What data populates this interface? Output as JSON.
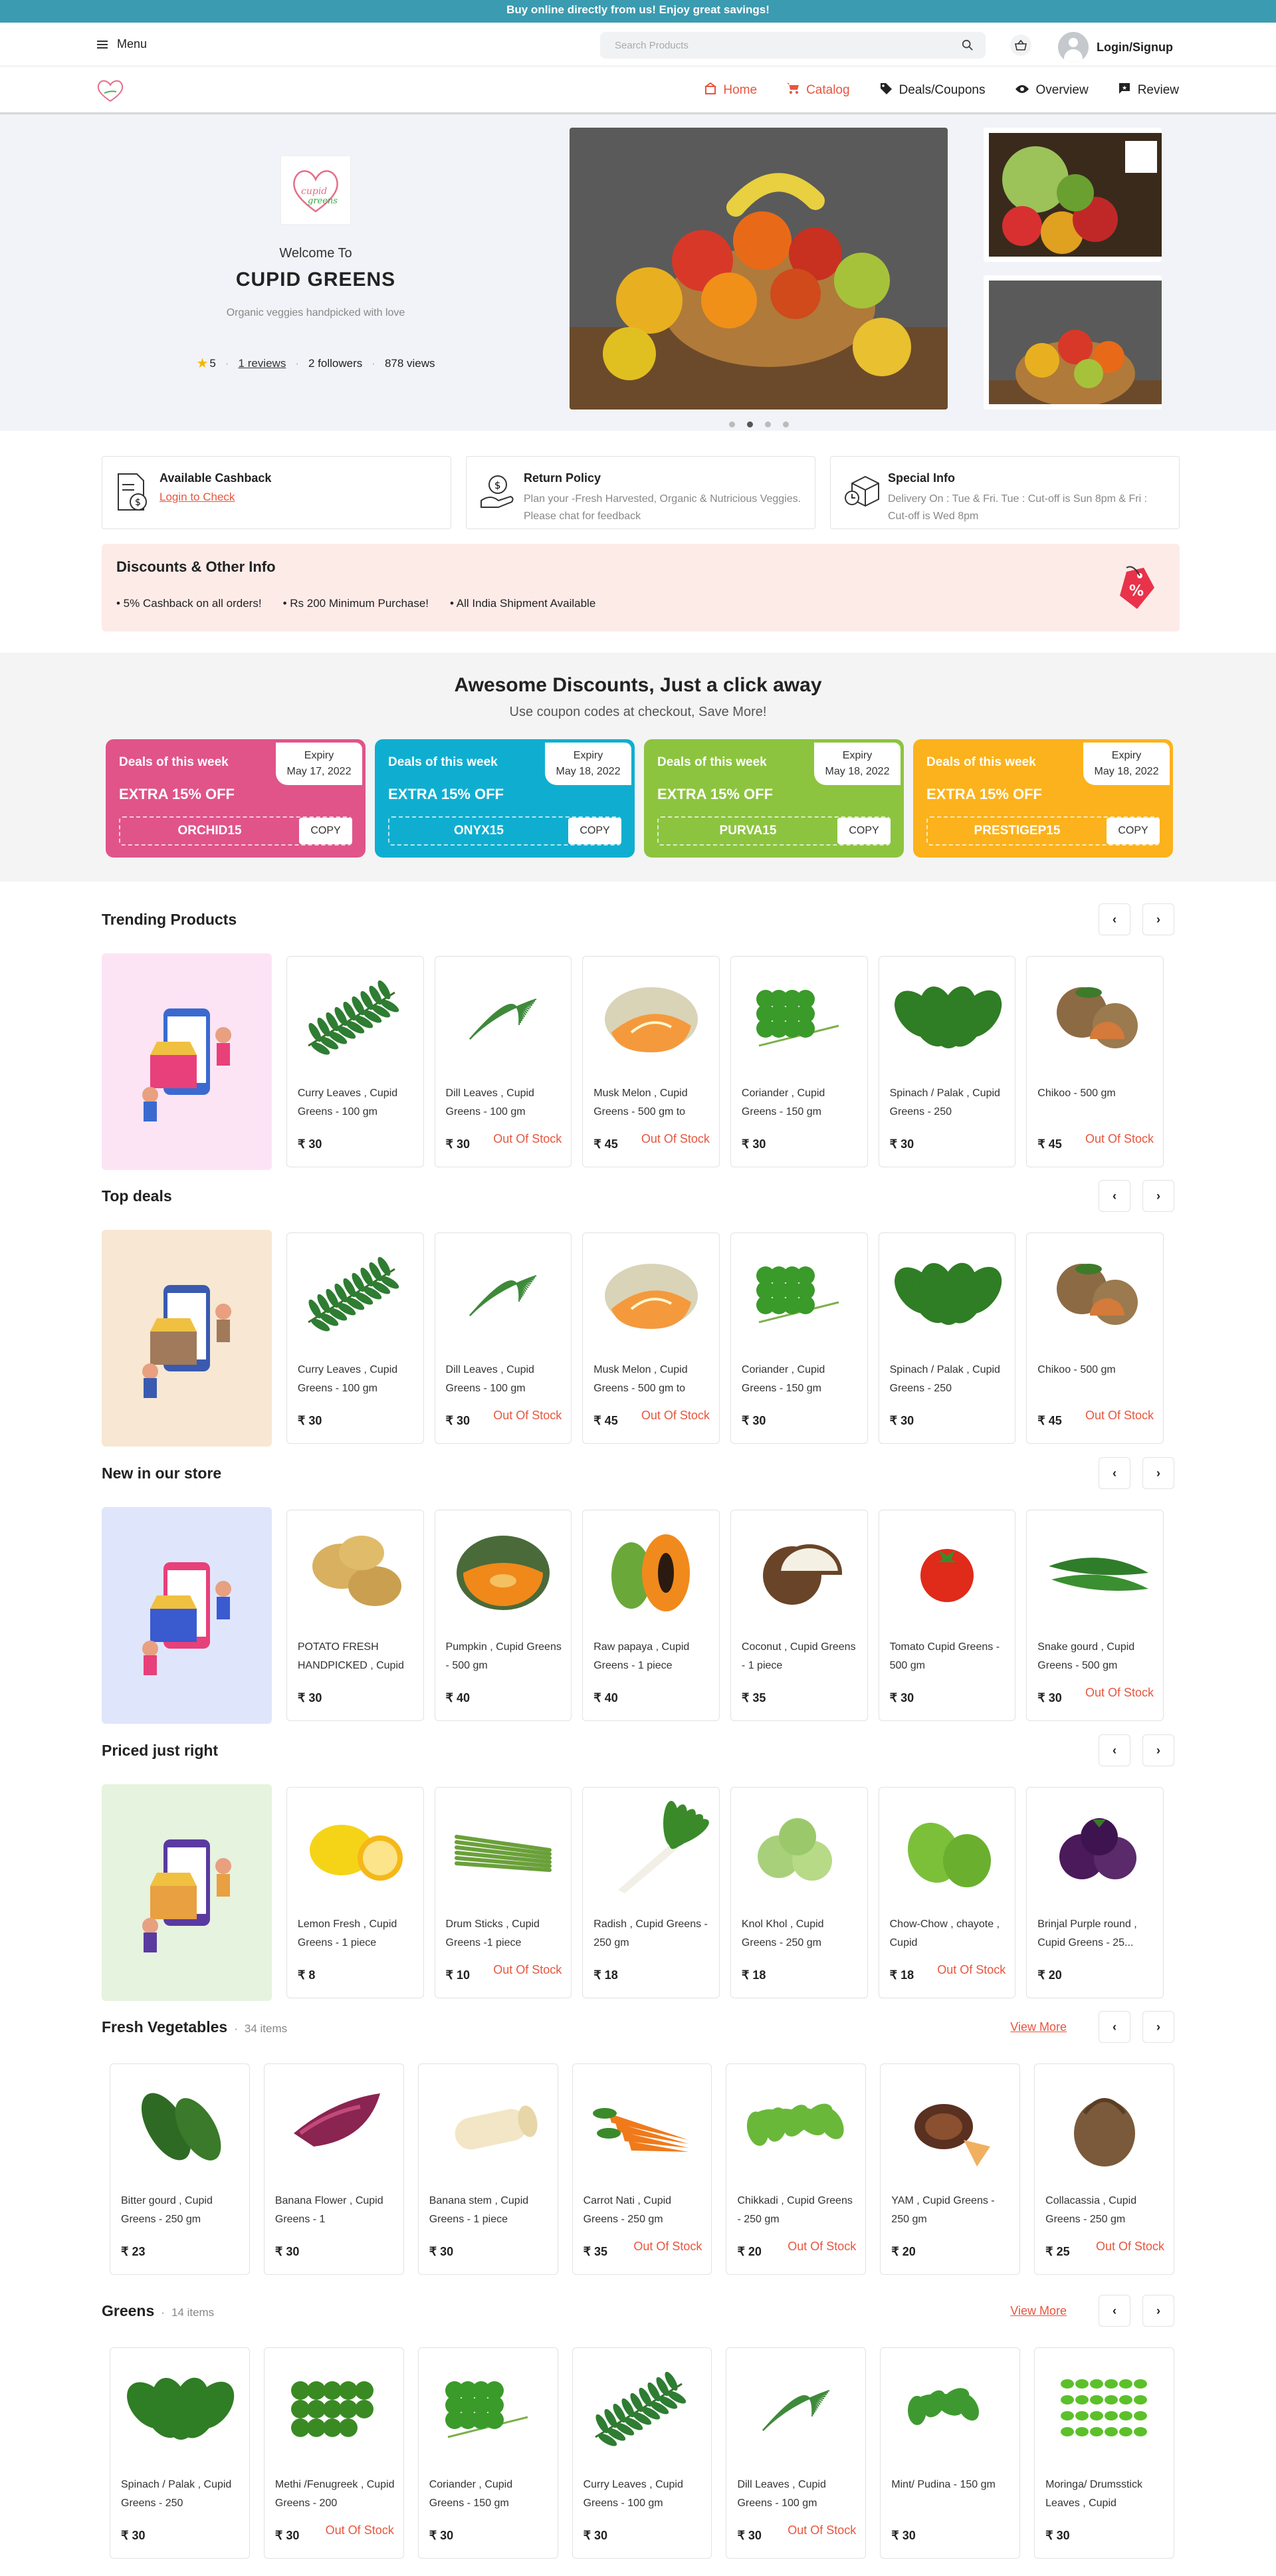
{
  "topbar": {
    "text": "Buy online directly from us! Enjoy great savings!"
  },
  "header": {
    "menu_label": "Menu",
    "search_placeholder": "Search Products",
    "login_label": "Login/Signup"
  },
  "nav": {
    "items": [
      {
        "label": "Home",
        "icon": "home-icon",
        "active": true
      },
      {
        "label": "Catalog",
        "icon": "cart-icon",
        "active": true
      },
      {
        "label": "Deals/Coupons",
        "icon": "tag-icon",
        "active": false
      },
      {
        "label": "Overview",
        "icon": "eye-icon",
        "active": false
      },
      {
        "label": "Review",
        "icon": "review-icon",
        "active": false
      }
    ]
  },
  "hero": {
    "welcome": "Welcome To",
    "store_name": "CUPID GREENS",
    "tagline": "Organic veggies handpicked with love",
    "rating": "5",
    "reviews": "1 reviews",
    "followers": "2 followers",
    "views": "878 views",
    "logo_text": "cupid greens",
    "slide_count": 4,
    "active_slide": 2
  },
  "info": {
    "cashback": {
      "title": "Available Cashback",
      "link": "Login to Check"
    },
    "returns": {
      "title": "Return Policy",
      "text": "Plan your -Fresh Harvested, Organic & Nutricious Veggies. Please chat for feedback"
    },
    "special": {
      "title": "Special Info",
      "text": "Delivery On : Tue & Fri. Tue : Cut-off is Sun 8pm & Fri : Cut-off is Wed 8pm"
    }
  },
  "discounts": {
    "title": "Discounts & Other Info",
    "items": [
      "• 5% Cashback on all orders!",
      "• Rs 200 Minimum Purchase!",
      "• All India Shipment Available"
    ]
  },
  "coupons": {
    "title": "Awesome Discounts, Just a click away",
    "subtitle": "Use coupon codes at checkout, Save More!",
    "copy_label": "COPY",
    "list": [
      {
        "deal": "Deals of this week",
        "offer": "EXTRA 15% OFF",
        "expiry_label": "Expiry",
        "expiry": "May 17, 2022",
        "code": "ORCHID15",
        "color": "#e0548a"
      },
      {
        "deal": "Deals of this week",
        "offer": "EXTRA 15% OFF",
        "expiry_label": "Expiry",
        "expiry": "May 18, 2022",
        "code": "ONYX15",
        "color": "#0faed0"
      },
      {
        "deal": "Deals of this week",
        "offer": "EXTRA 15% OFF",
        "expiry_label": "Expiry",
        "expiry": "May 18, 2022",
        "code": "PURVA15",
        "color": "#8cc43f"
      },
      {
        "deal": "Deals of this week",
        "offer": "EXTRA 15% OFF",
        "expiry_label": "Expiry",
        "expiry": "May 18, 2022",
        "code": "PRESTIGEP15",
        "color": "#fbb21c"
      }
    ]
  },
  "sections": [
    {
      "title": "Trending Products",
      "count": "",
      "view_more": "",
      "banner_color": "#fce4f5",
      "products": [
        {
          "name": "Curry Leaves , Cupid Greens - 100 gm",
          "price": "₹ 30",
          "stock": "",
          "img": "curry"
        },
        {
          "name": "Dill Leaves , Cupid Greens - 100 gm",
          "price": "₹ 30",
          "stock": "Out Of Stock",
          "img": "dill"
        },
        {
          "name": "Musk Melon , Cupid Greens - 500 gm to",
          "price": "₹ 45",
          "stock": "Out Of Stock",
          "img": "melon"
        },
        {
          "name": "Coriander , Cupid Greens - 150 gm",
          "price": "₹ 30",
          "stock": "",
          "img": "coriander"
        },
        {
          "name": "Spinach / Palak , Cupid Greens - 250",
          "price": "₹ 30",
          "stock": "",
          "img": "spinach"
        },
        {
          "name": "Chikoo - 500 gm",
          "price": "₹ 45",
          "stock": "Out Of Stock",
          "img": "chikoo"
        }
      ]
    },
    {
      "title": "Top deals",
      "count": "",
      "view_more": "",
      "banner_color": "#f7e7d3",
      "products": [
        {
          "name": "Curry Leaves , Cupid Greens - 100 gm",
          "price": "₹ 30",
          "stock": "",
          "img": "curry"
        },
        {
          "name": "Dill Leaves , Cupid Greens - 100 gm",
          "price": "₹ 30",
          "stock": "Out Of Stock",
          "img": "dill"
        },
        {
          "name": "Musk Melon , Cupid Greens - 500 gm to",
          "price": "₹ 45",
          "stock": "Out Of Stock",
          "img": "melon"
        },
        {
          "name": "Coriander , Cupid Greens - 150 gm",
          "price": "₹ 30",
          "stock": "",
          "img": "coriander"
        },
        {
          "name": "Spinach / Palak , Cupid Greens - 250",
          "price": "₹ 30",
          "stock": "",
          "img": "spinach"
        },
        {
          "name": "Chikoo - 500 gm",
          "price": "₹ 45",
          "stock": "Out Of Stock",
          "img": "chikoo"
        }
      ]
    },
    {
      "title": "New in our store",
      "count": "",
      "view_more": "",
      "banner_color": "#dfe6fb",
      "products": [
        {
          "name": "POTATO FRESH HANDPICKED , Cupid",
          "price": "₹ 30",
          "stock": "",
          "img": "potato"
        },
        {
          "name": "Pumpkin , Cupid Greens - 500 gm",
          "price": "₹ 40",
          "stock": "",
          "img": "pumpkin"
        },
        {
          "name": "Raw papaya , Cupid Greens - 1 piece",
          "price": "₹ 40",
          "stock": "",
          "img": "papaya"
        },
        {
          "name": "Coconut , Cupid Greens - 1 piece",
          "price": "₹ 35",
          "stock": "",
          "img": "coconut"
        },
        {
          "name": "Tomato Cupid Greens - 500 gm",
          "price": "₹ 30",
          "stock": "",
          "img": "tomato"
        },
        {
          "name": "Snake gourd , Cupid Greens - 500 gm",
          "price": "₹ 30",
          "stock": "Out Of Stock",
          "img": "gourd"
        }
      ]
    },
    {
      "title": "Priced just right",
      "count": "",
      "view_more": "",
      "banner_color": "#e6f3df",
      "products": [
        {
          "name": "Lemon Fresh , Cupid Greens - 1 piece",
          "price": "₹ 8",
          "stock": "",
          "img": "lemon"
        },
        {
          "name": "Drum Sticks , Cupid Greens -1 piece",
          "price": "₹ 10",
          "stock": "Out Of Stock",
          "img": "drumstick"
        },
        {
          "name": "Radish , Cupid Greens - 250 gm",
          "price": "₹ 18",
          "stock": "",
          "img": "radish"
        },
        {
          "name": "Knol Khol , Cupid Greens - 250 gm",
          "price": "₹ 18",
          "stock": "",
          "img": "knolkhol"
        },
        {
          "name": "Chow-Chow , chayote , Cupid",
          "price": "₹ 18",
          "stock": "Out Of Stock",
          "img": "chayote"
        },
        {
          "name": "Brinjal Purple round , Cupid Greens - 25...",
          "price": "₹ 20",
          "stock": "",
          "img": "brinjal"
        }
      ]
    },
    {
      "title": "Fresh Vegetables",
      "count": "34 items",
      "view_more": "View More",
      "banner_color": "",
      "products": [
        {
          "name": "Bitter gourd , Cupid Greens - 250 gm",
          "price": "₹ 23",
          "stock": "",
          "img": "bitter"
        },
        {
          "name": "Banana Flower , Cupid Greens - 1",
          "price": "₹ 30",
          "stock": "",
          "img": "bananaflower"
        },
        {
          "name": "Banana stem , Cupid Greens - 1 piece",
          "price": "₹ 30",
          "stock": "",
          "img": "bananastem"
        },
        {
          "name": "Carrot Nati , Cupid Greens - 250 gm",
          "price": "₹ 35",
          "stock": "Out Of Stock",
          "img": "carrot"
        },
        {
          "name": "Chikkadi , Cupid Greens - 250 gm",
          "price": "₹ 20",
          "stock": "Out Of Stock",
          "img": "chikkadi"
        },
        {
          "name": "YAM , Cupid Greens - 250 gm",
          "price": "₹ 20",
          "stock": "",
          "img": "yam"
        },
        {
          "name": "Collacassia , Cupid Greens - 250 gm",
          "price": "₹ 25",
          "stock": "Out Of Stock",
          "img": "colocasia"
        }
      ]
    },
    {
      "title": "Greens",
      "count": "14 items",
      "view_more": "View More",
      "banner_color": "",
      "products": [
        {
          "name": "Spinach / Palak , Cupid Greens - 250",
          "price": "₹ 30",
          "stock": "",
          "img": "spinach"
        },
        {
          "name": "Methi /Fenugreek , Cupid Greens - 200",
          "price": "₹ 30",
          "stock": "Out Of Stock",
          "img": "methi"
        },
        {
          "name": "Coriander , Cupid Greens - 150 gm",
          "price": "₹ 30",
          "stock": "",
          "img": "coriander"
        },
        {
          "name": "Curry Leaves , Cupid Greens - 100 gm",
          "price": "₹ 30",
          "stock": "",
          "img": "curry"
        },
        {
          "name": "Dill Leaves , Cupid Greens - 100 gm",
          "price": "₹ 30",
          "stock": "Out Of Stock",
          "img": "dill"
        },
        {
          "name": "Mint/ Pudina - 150 gm",
          "price": "₹ 30",
          "stock": "",
          "img": "mint"
        },
        {
          "name": "Moringa/ Drumsstick Leaves , Cupid",
          "price": "₹ 30",
          "stock": "",
          "img": "moringa"
        }
      ]
    }
  ]
}
